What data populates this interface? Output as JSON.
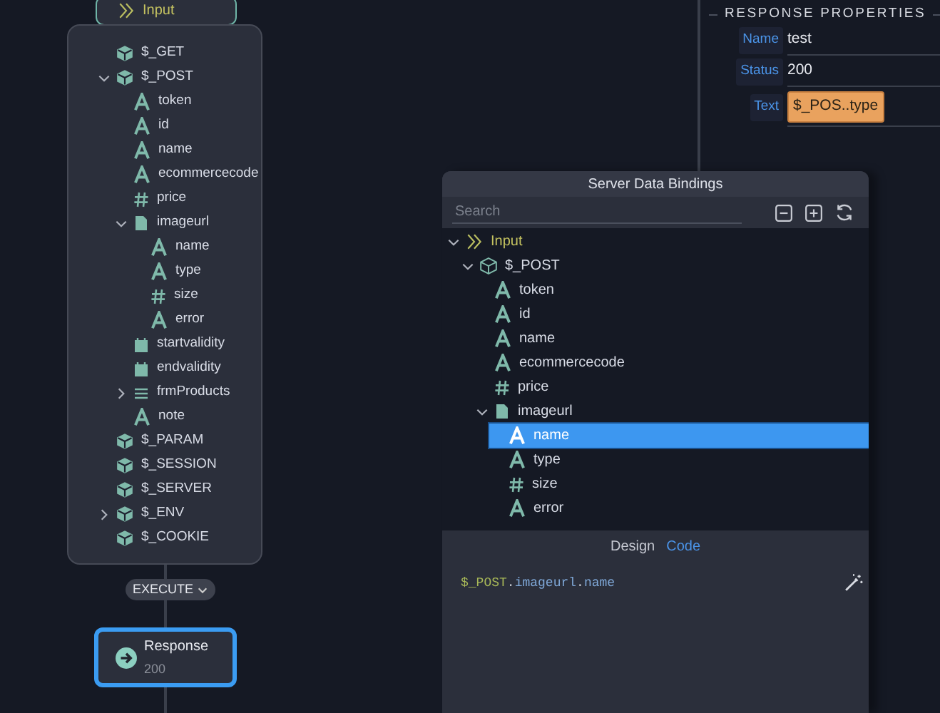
{
  "input_node": {
    "label": "Input"
  },
  "tree": [
    {
      "label": "$_GET",
      "kind": "object"
    },
    {
      "label": "$_POST",
      "kind": "object",
      "expanded": true,
      "children": [
        {
          "label": "token",
          "kind": "text"
        },
        {
          "label": "id",
          "kind": "text"
        },
        {
          "label": "name",
          "kind": "text"
        },
        {
          "label": "ecommercecode",
          "kind": "text"
        },
        {
          "label": "price",
          "kind": "number"
        },
        {
          "label": "imageurl",
          "kind": "file",
          "expanded": true,
          "children": [
            {
              "label": "name",
              "kind": "text"
            },
            {
              "label": "type",
              "kind": "text"
            },
            {
              "label": "size",
              "kind": "number"
            },
            {
              "label": "error",
              "kind": "text"
            }
          ]
        },
        {
          "label": "startvalidity",
          "kind": "date"
        },
        {
          "label": "endvalidity",
          "kind": "date"
        },
        {
          "label": "frmProducts",
          "kind": "array",
          "expanded": false
        },
        {
          "label": "note",
          "kind": "text"
        }
      ]
    },
    {
      "label": "$_PARAM",
      "kind": "object"
    },
    {
      "label": "$_SESSION",
      "kind": "object"
    },
    {
      "label": "$_SERVER",
      "kind": "object"
    },
    {
      "label": "$_ENV",
      "kind": "object",
      "expanded": false
    },
    {
      "label": "$_COOKIE",
      "kind": "object"
    }
  ],
  "execute": {
    "label": "EXECUTE"
  },
  "response_node": {
    "title": "Response",
    "status": "200",
    "selected": true
  },
  "properties": {
    "title": "RESPONSE PROPERTIES",
    "fields": [
      {
        "label": "Name",
        "value": "test",
        "kind": "text"
      },
      {
        "label": "Status",
        "value": "200",
        "kind": "text"
      },
      {
        "label": "Text",
        "value": "$_POS..type",
        "kind": "binding"
      }
    ]
  },
  "dialog": {
    "title": "Server Data Bindings",
    "search": {
      "placeholder": "Search"
    },
    "tree": [
      {
        "label": "Input",
        "kind": "input",
        "expanded": true,
        "selected": false,
        "children": [
          {
            "label": "$_POST",
            "kind": "object",
            "expanded": true,
            "selected": false,
            "children": [
              {
                "label": "token",
                "kind": "text",
                "selected": false
              },
              {
                "label": "id",
                "kind": "text",
                "selected": false
              },
              {
                "label": "name",
                "kind": "text",
                "selected": false
              },
              {
                "label": "ecommercecode",
                "kind": "text",
                "selected": false
              },
              {
                "label": "price",
                "kind": "number",
                "selected": false
              },
              {
                "label": "imageurl",
                "kind": "file",
                "expanded": true,
                "selected": false,
                "children": [
                  {
                    "label": "name",
                    "kind": "text",
                    "selected": true
                  },
                  {
                    "label": "type",
                    "kind": "text",
                    "selected": false
                  },
                  {
                    "label": "size",
                    "kind": "number",
                    "selected": false
                  },
                  {
                    "label": "error",
                    "kind": "text",
                    "selected": false
                  }
                ]
              }
            ]
          }
        ]
      }
    ],
    "tabs": [
      {
        "label": "Design",
        "selected": false
      },
      {
        "label": "Code",
        "selected": true
      }
    ],
    "code": [
      {
        "text": "$_POST",
        "kind": "variable"
      },
      {
        "text": ".",
        "kind": "punct"
      },
      {
        "text": "imageurl",
        "kind": "property"
      },
      {
        "text": ".",
        "kind": "punct"
      },
      {
        "text": "name",
        "kind": "property"
      }
    ]
  }
}
